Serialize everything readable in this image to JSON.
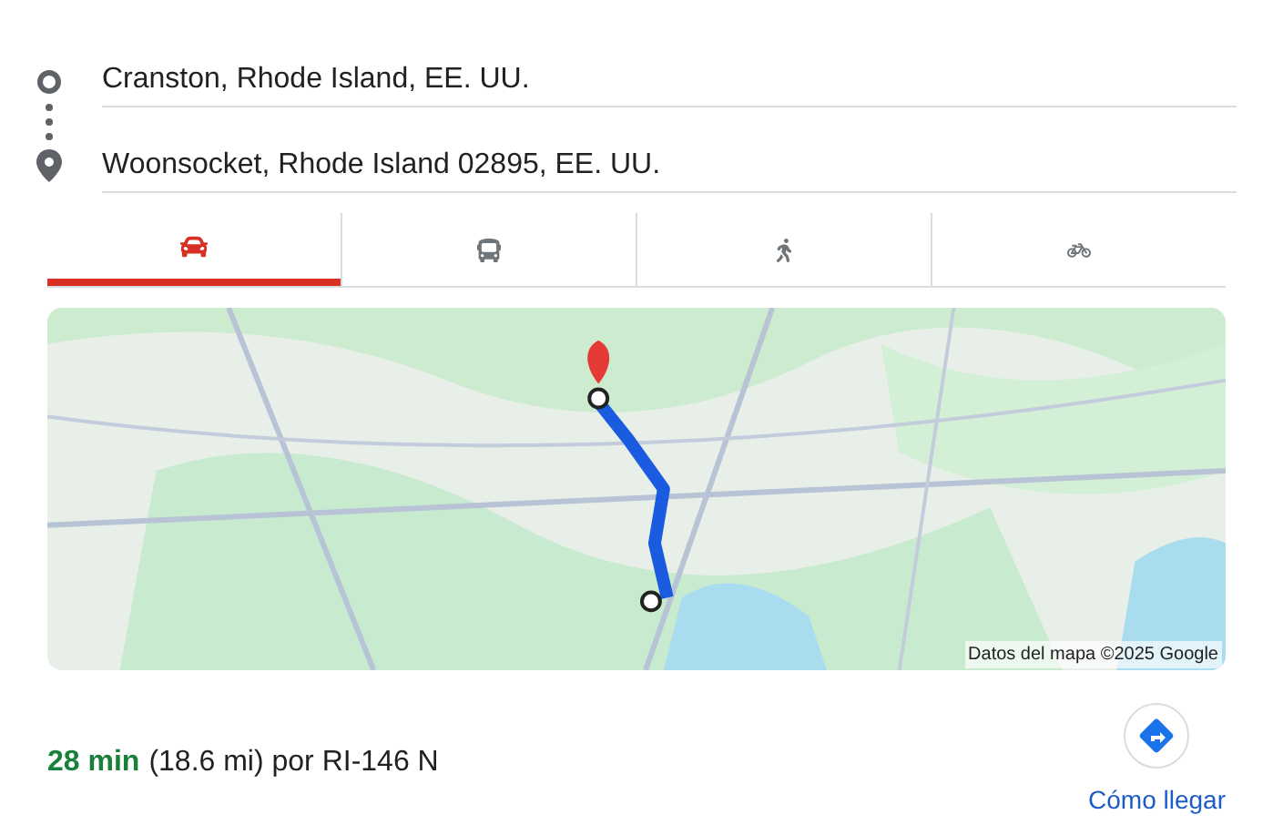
{
  "route": {
    "origin": "Cranston, Rhode Island, EE. UU.",
    "destination": "Woonsocket, Rhode Island 02895, EE. UU."
  },
  "modes": [
    {
      "kind": "car",
      "selected": true
    },
    {
      "kind": "transit",
      "selected": false
    },
    {
      "kind": "walk",
      "selected": false
    },
    {
      "kind": "bike",
      "selected": false
    }
  ],
  "map": {
    "kind": "picture",
    "attribution": "Datos del mapa ©2025 Google"
  },
  "summary": {
    "duration": "28 min",
    "details": "(18.6 mi) por RI-146 N"
  },
  "directions_link": "Cómo llegar"
}
